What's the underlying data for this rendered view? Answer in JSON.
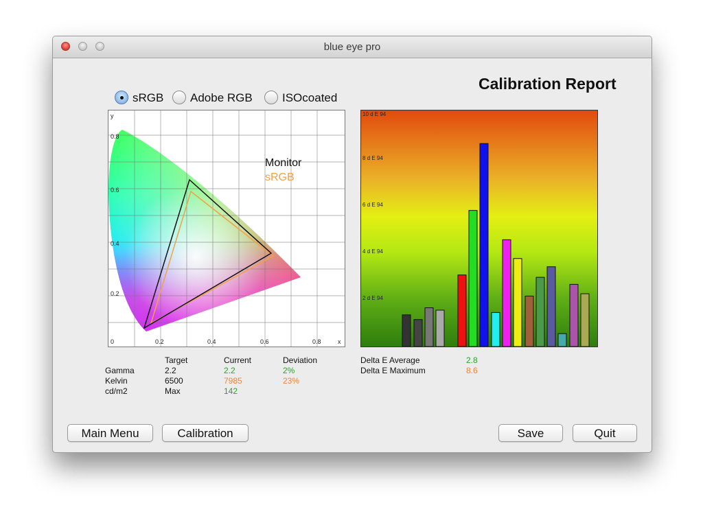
{
  "window": {
    "title": "blue eye pro"
  },
  "report_title": "Calibration Report",
  "profiles": {
    "options": [
      "sRGB",
      "Adobe RGB",
      "ISOcoated"
    ],
    "selected": "sRGB"
  },
  "cie_chart": {
    "x_label": "x",
    "y_label": "y",
    "x_ticks": [
      "0",
      "0.2",
      "0.4",
      "0.6",
      "0.8"
    ],
    "y_ticks": [
      "0.8",
      "0.6",
      "0.4",
      "0.2"
    ],
    "legend": [
      {
        "label": "Monitor",
        "color": "#111111"
      },
      {
        "label": "sRGB",
        "color": "#f2a145"
      }
    ]
  },
  "stats": {
    "headers": [
      "Target",
      "Current",
      "Deviation"
    ],
    "rows": [
      {
        "label": "Gamma",
        "target": "2.2",
        "current": "2.2",
        "deviation": "2%"
      },
      {
        "label": "Kelvin",
        "target": "6500",
        "current": "7985",
        "deviation": "23%"
      },
      {
        "label": "cd/m2",
        "target": "Max",
        "current": "142",
        "deviation": ""
      }
    ]
  },
  "delta_e": {
    "average_label": "Delta E Average",
    "average_value": "2.8",
    "maximum_label": "Delta E Maximum",
    "maximum_value": "8.6"
  },
  "buttons": {
    "main_menu": "Main Menu",
    "calibration": "Calibration",
    "save": "Save",
    "quit": "Quit"
  },
  "chart_data": {
    "type": "bar",
    "ylabel": "",
    "y_ticks": [
      "10 d E 94",
      "8 d E 94",
      "6 d E 94",
      "4 d E 94",
      "2 d E 94"
    ],
    "ylim": [
      0,
      10
    ],
    "values": [
      1.35,
      1.15,
      1.65,
      1.55,
      3.05,
      5.8,
      8.65,
      1.45,
      4.55,
      3.75,
      2.15,
      2.95,
      3.4,
      0.55,
      2.65,
      2.25
    ],
    "colors": [
      "#333333",
      "#444444",
      "#777777",
      "#aaaaaa",
      "#ee1111",
      "#22dd22",
      "#1111ee",
      "#22eeee",
      "#ee22ee",
      "#eeee11",
      "#a0603a",
      "#4a9a4a",
      "#5a5aa0",
      "#44aaaa",
      "#aa55aa",
      "#aaaa55"
    ]
  }
}
